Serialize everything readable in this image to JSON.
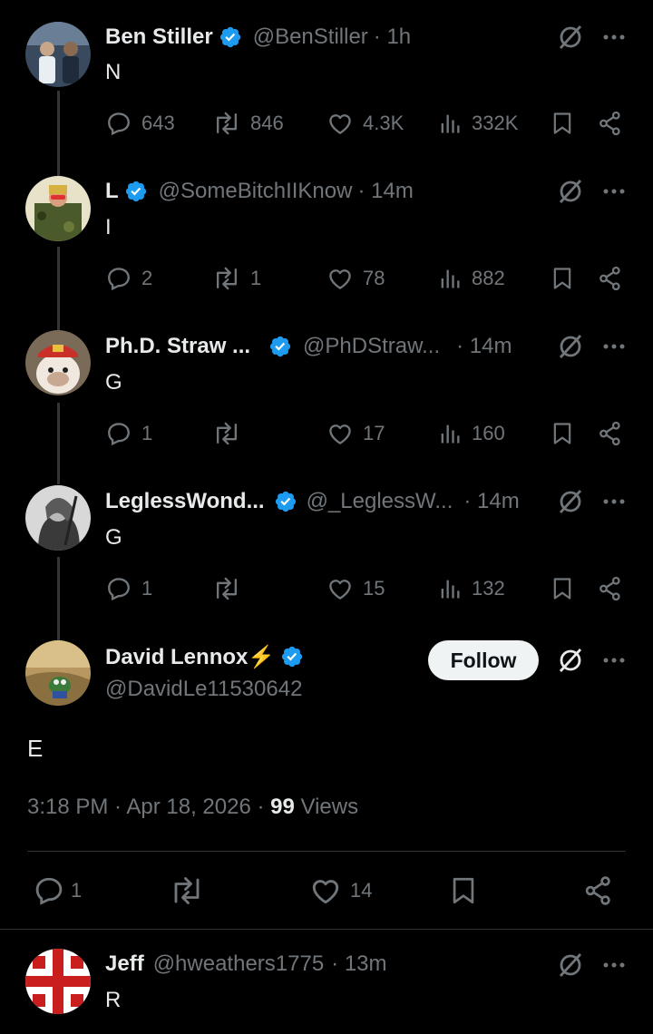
{
  "colors": {
    "background": "#000000",
    "text": "#e7e9ea",
    "muted": "#71767b",
    "verified": "#1d9bf0"
  },
  "replies": [
    {
      "name": "Ben Stiller",
      "handle": "@BenStiller",
      "time": "· 1h",
      "text": "N",
      "comments": "643",
      "reposts": "846",
      "likes": "4.3K",
      "views": "332K"
    },
    {
      "name": "L",
      "handle": "@SomeBitchIIKnow",
      "time": "· 14m",
      "text": "I",
      "comments": "2",
      "reposts": "1",
      "likes": "78",
      "views": "882"
    },
    {
      "name": "Ph.D. Straw ...",
      "handle": "@PhDStraw...",
      "time": "· 14m",
      "text": "G",
      "comments": "1",
      "reposts": "",
      "likes": "17",
      "views": "160"
    },
    {
      "name": "LeglessWond...",
      "handle": "@_LeglessW...",
      "time": "· 14m",
      "text": "G",
      "comments": "1",
      "reposts": "",
      "likes": "15",
      "views": "132"
    }
  ],
  "main_post": {
    "name": "David Lennox⚡",
    "handle": "@DavidLe11530642",
    "follow_label": "Follow",
    "text": "E",
    "timestamp": "3:18 PM · Apr 18, 2026 · ",
    "views_count": "99",
    "views_label": " Views",
    "comments": "1",
    "reposts": "",
    "likes": "14"
  },
  "bottom_reply": {
    "name": "Jeff",
    "handle": "@hweathers1775",
    "time": "· 13m",
    "text": "R"
  },
  "icons": [
    "verified-badge-icon",
    "grok-icon",
    "more-icon",
    "reply-icon",
    "repost-icon",
    "like-icon",
    "views-icon",
    "bookmark-icon",
    "share-icon"
  ]
}
